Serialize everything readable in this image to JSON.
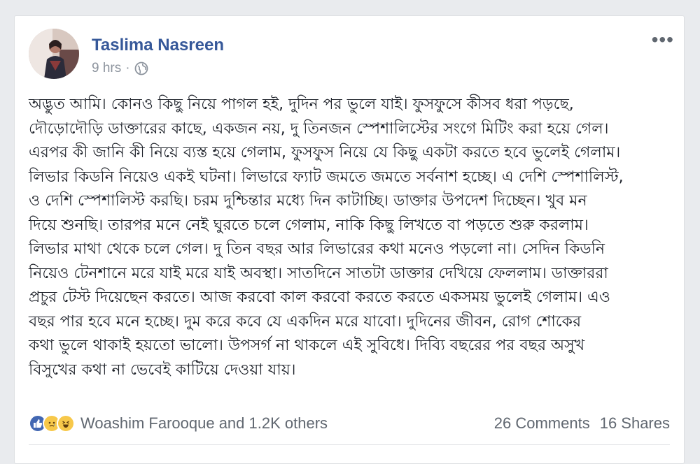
{
  "post": {
    "author": "Taslima Nasreen",
    "time": "9 hrs",
    "time_separator": "·",
    "privacy_icon": "globe-icon",
    "more_icon": "ellipsis-icon",
    "more_label": "•••",
    "text": "অদ্ভুত আমি। কোনও কিছু নিয়ে পাগল হই, দুদিন পর ভুলে যাই। ফুসফুসে কীসব ধরা পড়ছে,\nদৌড়োদৌড়ি ডাক্তারের কাছে, একজন নয়, দু তিনজন স্পেশালিস্টের সংগে মিটিং করা হয়ে গেল।\nএরপর কী জানি কী নিয়ে ব্যস্ত হয়ে গেলাম, ফুসফুস নিয়ে যে কিছু একটা করতে হবে ভুলেই গেলাম।\nলিভার কিডনি নিয়েও একই ঘটনা। লিভারে ফ্যাট জমতে জমতে সর্বনাশ হচ্ছে। এ দেশি স্পেশালিস্ট,\nও দেশি স্পেশালিস্ট করছি। চরম দুশ্চিন্তার মধ্যে দিন কাটাচ্ছি। ডাক্তার উপদেশ দিচ্ছেন। খুব মন\nদিয়ে শুনছি। তারপর মনে নেই ঘুরতে চলে গেলাম, নাকি কিছু লিখতে বা পড়তে শুরু করলাম।\nলিভার মাথা থেকে চলে গেল। দু তিন বছর আর লিভারের কথা মনেও পড়লো না। সেদিন কিডনি\nনিয়েও টেনশানে মরে যাই মরে যাই অবস্থা। সাতদিনে সাতটা ডাক্তার দেখিয়ে ফেললাম। ডাক্তাররা\nপ্রচুর টেস্ট দিয়েছেন করতে। আজ করবো কাল করবো করতে করতে একসময় ভুলেই গেলাম। এও\nবছর পার হবে মনে হচ্ছে। দুম করে কবে যে একদিন মরে যাবো। দুদিনের জীবন, রোগ শোকের\nকথা ভুলে থাকাই হয়তো ভালো। উপসর্গ না থাকলে এই সুবিধে। দিব্যি বছরের পর বছর অসুখ\nবিসুখের কথা না ভেবেই কাটিয়ে দেওয়া যায়।"
  },
  "reactions": {
    "icons": [
      "like-icon",
      "sad-icon",
      "haha-icon"
    ],
    "summary": "Woashim Farooque and 1.2K others",
    "comments": "26 Comments",
    "shares": "16 Shares"
  },
  "colors": {
    "author": "#365899",
    "meta": "#8d949e",
    "like": "#4267b2",
    "emoji": "#f7c84a"
  }
}
